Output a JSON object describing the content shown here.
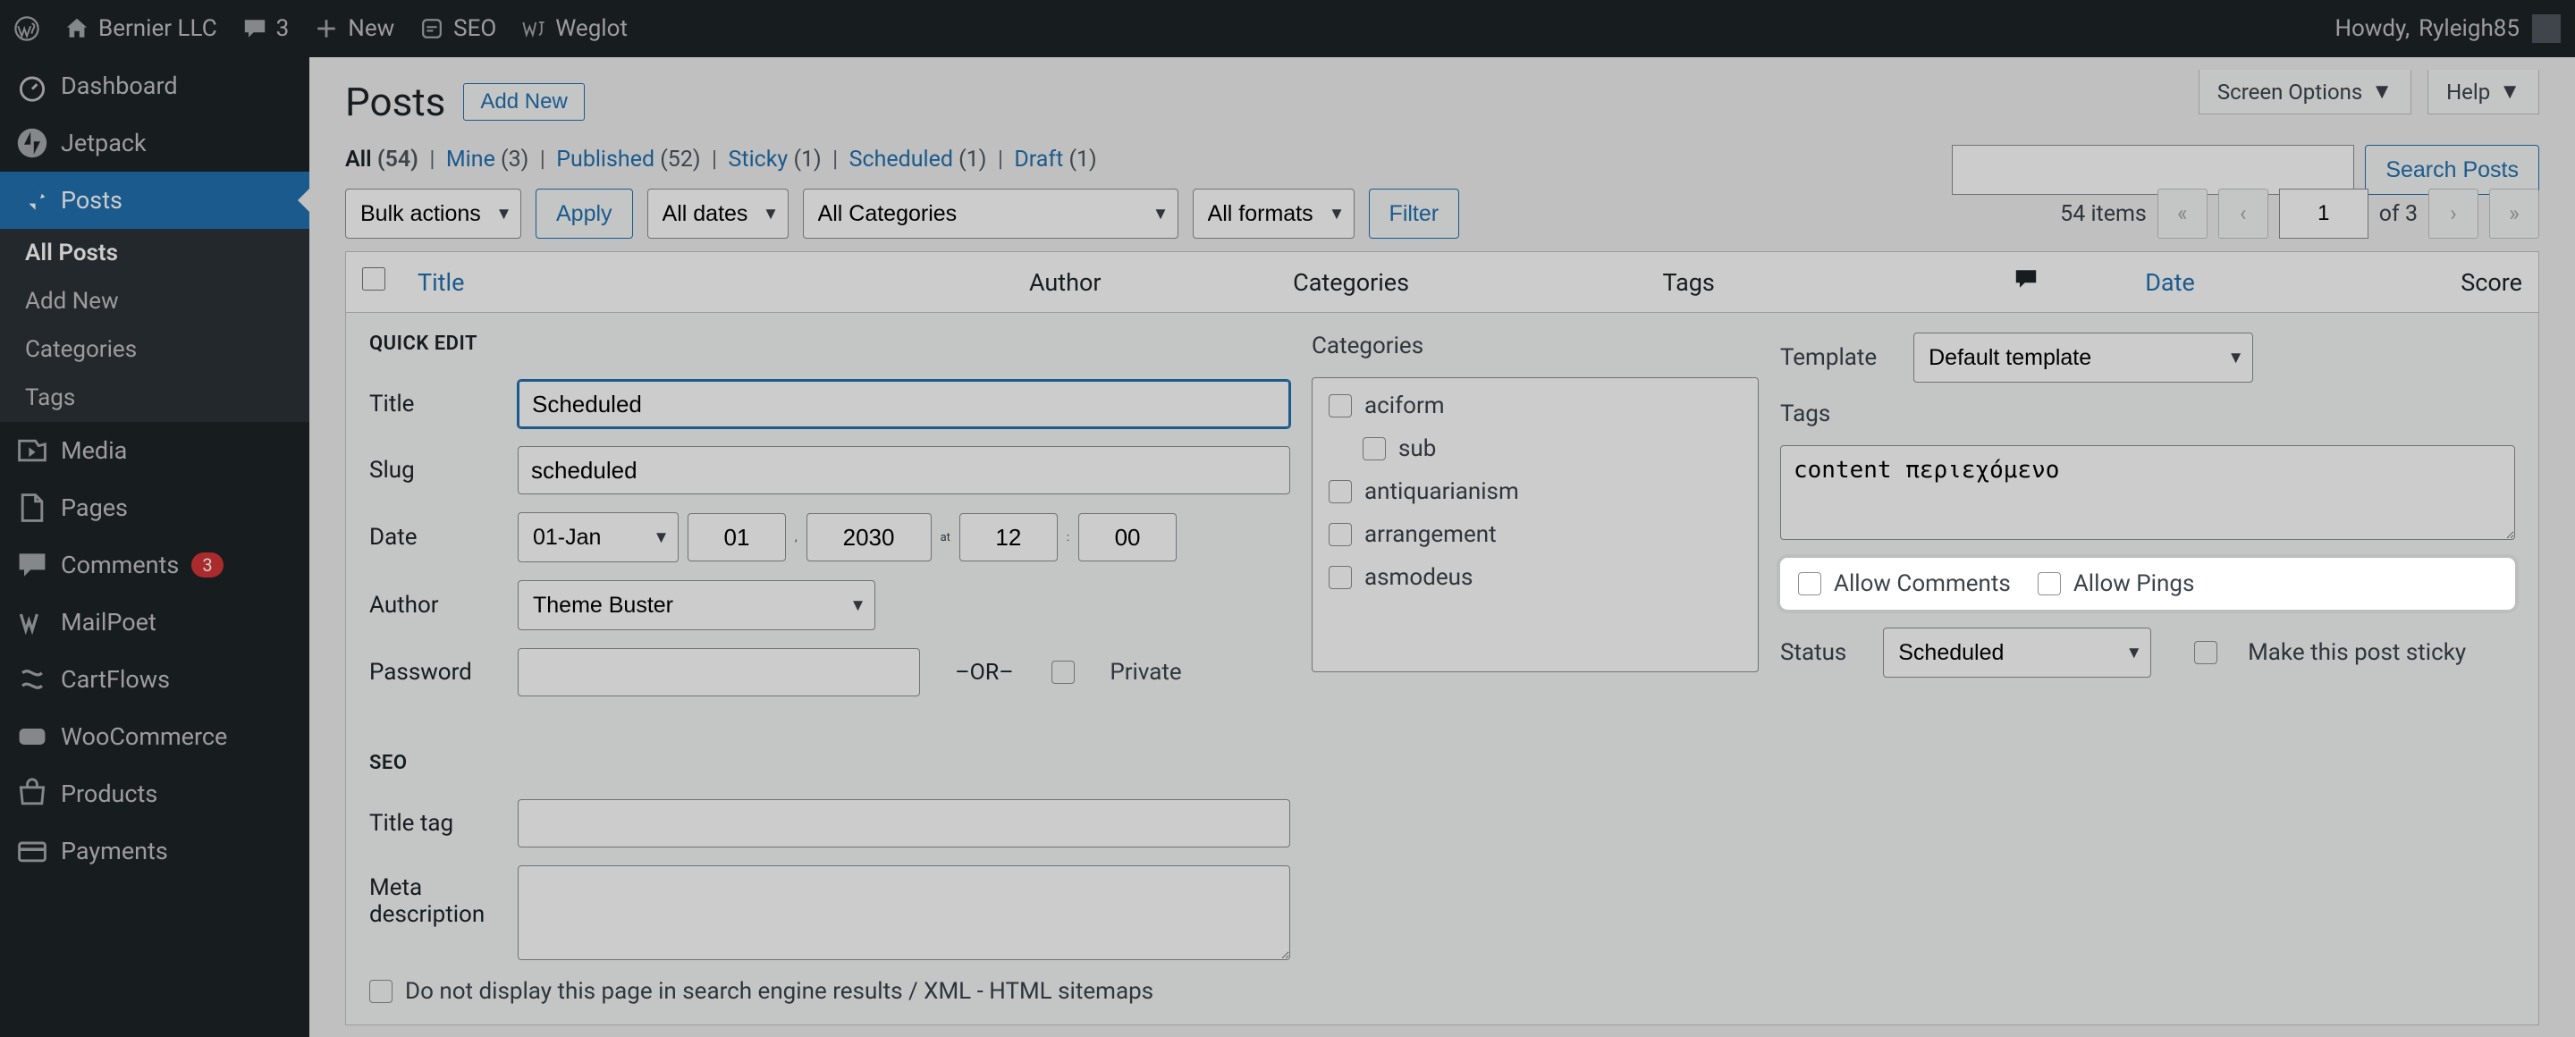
{
  "adminbar": {
    "site_name": "Bernier LLC",
    "comments_count": "3",
    "new_label": "New",
    "seo_label": "SEO",
    "weglot_label": "Weglot",
    "howdy_prefix": "Howdy, ",
    "user_name": "Ryleigh85"
  },
  "sidebar": {
    "items": [
      {
        "label": "Dashboard",
        "icon": "dashboard"
      },
      {
        "label": "Jetpack",
        "icon": "jetpack"
      },
      {
        "label": "Posts",
        "icon": "pin",
        "current": true
      },
      {
        "label": "Media",
        "icon": "media"
      },
      {
        "label": "Pages",
        "icon": "pages"
      },
      {
        "label": "Comments",
        "icon": "comments",
        "badge": "3"
      },
      {
        "label": "MailPoet",
        "icon": "mailpoet"
      },
      {
        "label": "CartFlows",
        "icon": "cartflows"
      },
      {
        "label": "WooCommerce",
        "icon": "woo"
      },
      {
        "label": "Products",
        "icon": "products"
      },
      {
        "label": "Payments",
        "icon": "payments"
      }
    ],
    "submenu": [
      {
        "label": "All Posts",
        "current": true
      },
      {
        "label": "Add New"
      },
      {
        "label": "Categories"
      },
      {
        "label": "Tags"
      }
    ]
  },
  "header": {
    "page_title": "Posts",
    "add_new": "Add New",
    "screen_options": "Screen Options",
    "help": "Help"
  },
  "filters": {
    "all": "All",
    "all_count": "(54)",
    "mine": "Mine",
    "mine_count": "(3)",
    "published": "Published",
    "published_count": "(52)",
    "sticky": "Sticky",
    "sticky_count": "(1)",
    "scheduled": "Scheduled",
    "scheduled_count": "(1)",
    "draft": "Draft",
    "draft_count": "(1)"
  },
  "search": {
    "button": "Search Posts"
  },
  "tablenav": {
    "bulk_actions": "Bulk actions",
    "apply": "Apply",
    "all_dates": "All dates",
    "all_categories": "All Categories",
    "all_formats": "All formats",
    "filter": "Filter",
    "items_count": "54 items",
    "page_current": "1",
    "page_of": "of 3"
  },
  "columns": {
    "title": "Title",
    "author": "Author",
    "categories": "Categories",
    "tags": "Tags",
    "date": "Date",
    "score": "Score"
  },
  "quick_edit": {
    "legend": "QUICK EDIT",
    "title_label": "Title",
    "title_value": "Scheduled",
    "slug_label": "Slug",
    "slug_value": "scheduled",
    "date_label": "Date",
    "month_value": "01-Jan",
    "day_value": "01",
    "year_value": "2030",
    "at": "at",
    "hour_value": "12",
    "minute_value": "00",
    "author_label": "Author",
    "author_value": "Theme Buster",
    "password_label": "Password",
    "or": "–OR–",
    "private_label": "Private",
    "seo_legend": "SEO",
    "titletag_label": "Title tag",
    "metadesc_label": "Meta description",
    "noindex_label": "Do not display this page in search engine results / XML - HTML sitemaps",
    "categories_label": "Categories",
    "cat_items": [
      "aciform",
      "sub",
      "antiquarianism",
      "arrangement",
      "asmodeus"
    ],
    "template_label": "Template",
    "template_value": "Default template",
    "tags_label": "Tags",
    "tags_value": "content περιεχόμενο",
    "allow_comments": "Allow Comments",
    "allow_pings": "Allow Pings",
    "status_label": "Status",
    "status_value": "Scheduled",
    "sticky_label": "Make this post sticky"
  }
}
